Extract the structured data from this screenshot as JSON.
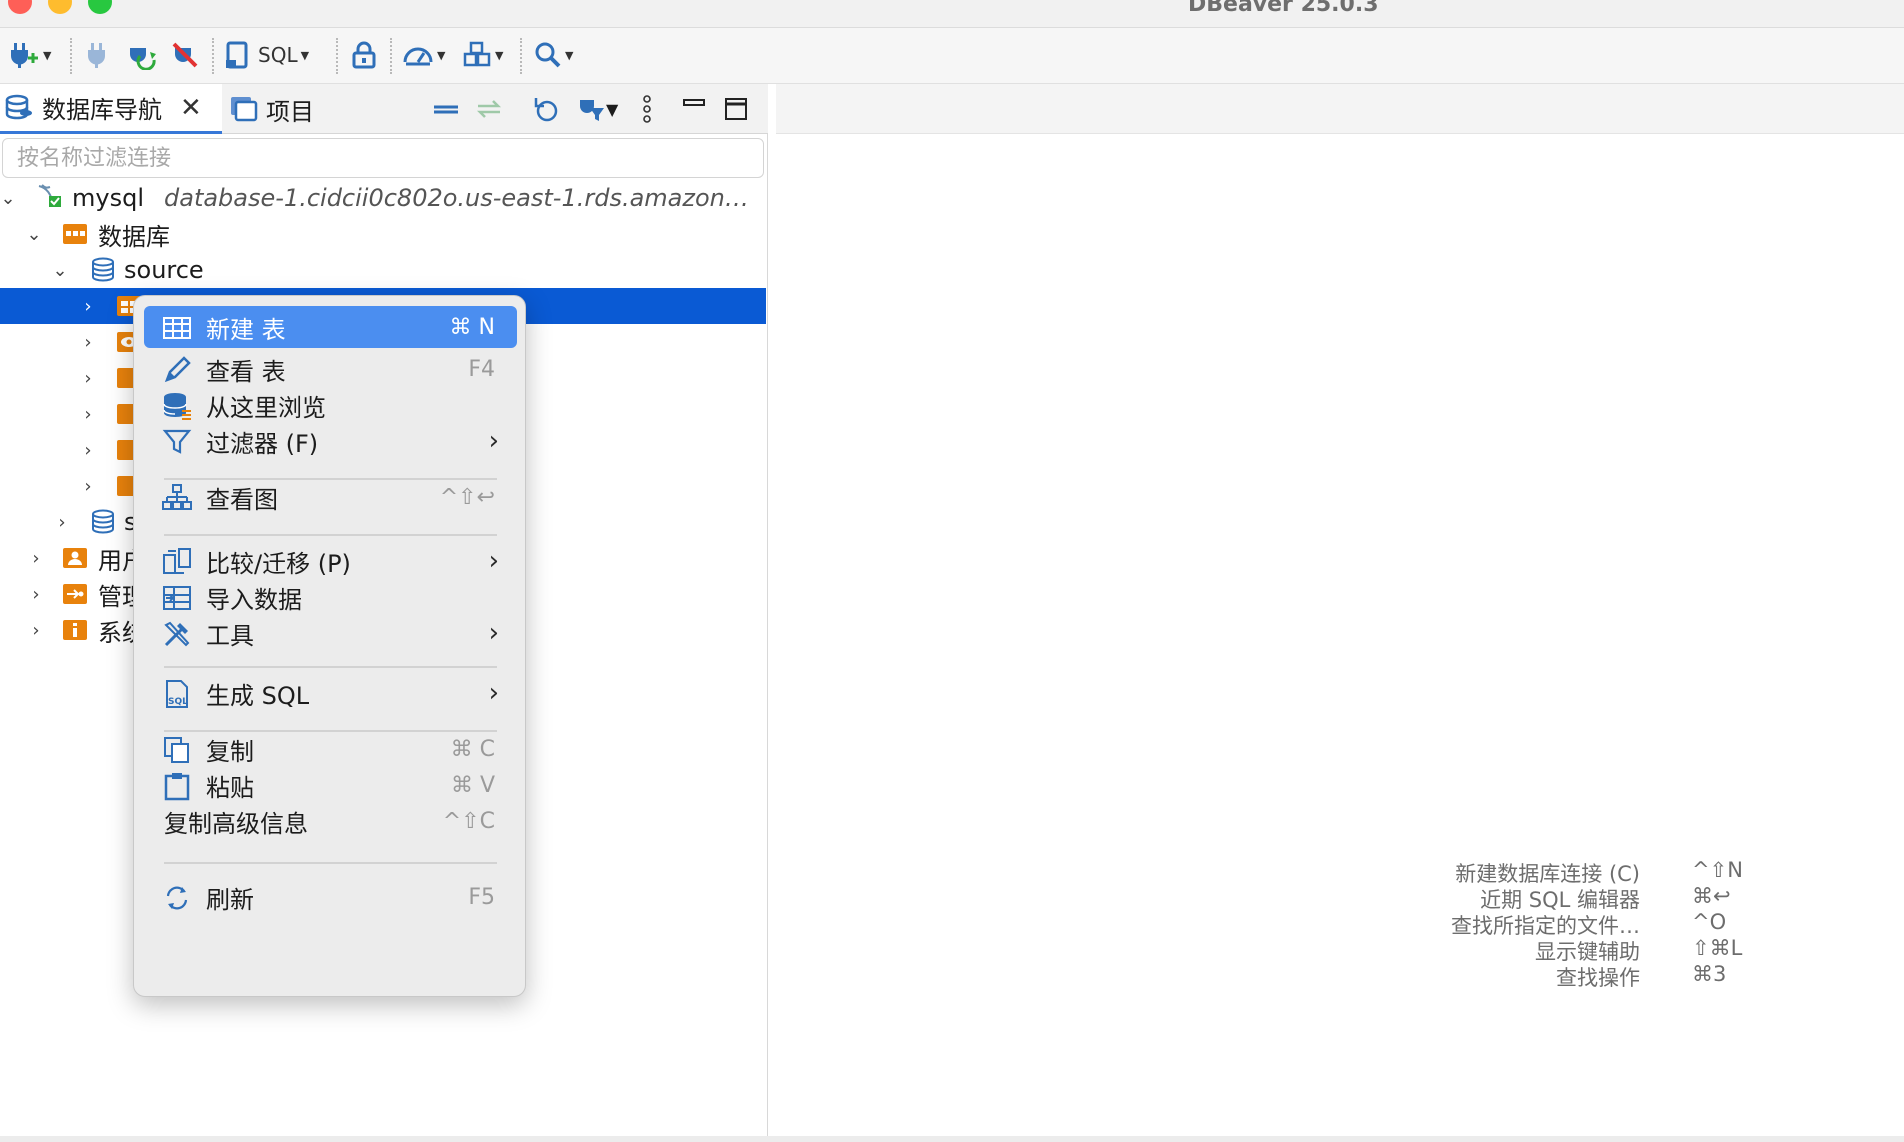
{
  "window": {
    "title": "DBeaver 25.0.3"
  },
  "toolbar": {
    "sql_label": "SQL"
  },
  "left_panel": {
    "tabs": [
      {
        "label": "数据库导航"
      },
      {
        "label": "项目"
      }
    ],
    "filter_placeholder": "按名称过滤连接",
    "tree": {
      "connection": {
        "name": "mysql",
        "host": "database-1.cidcii0c802o.us-east-1.rds.amazon…"
      },
      "databases_label": "数据库",
      "schema": "source",
      "schema2_partial": "s",
      "users_partial": "用户",
      "admin_partial": "管理",
      "system_partial": "系统"
    }
  },
  "context_menu": {
    "new_table": {
      "label": "新建 表",
      "shortcut": "⌘ N"
    },
    "view_table": {
      "label": "查看 表",
      "shortcut": "F4"
    },
    "browse_here": {
      "label": "从这里浏览"
    },
    "filter": {
      "label": "过滤器 (F)"
    },
    "view_diagram": {
      "label": "查看图",
      "shortcut": "^⇧↩"
    },
    "compare_migrate": {
      "label": "比较/迁移 (P)"
    },
    "import_data": {
      "label": "导入数据"
    },
    "tools": {
      "label": "工具"
    },
    "generate_sql": {
      "label": "生成 SQL"
    },
    "copy": {
      "label": "复制",
      "shortcut": "⌘ C"
    },
    "paste": {
      "label": "粘贴",
      "shortcut": "⌘ V"
    },
    "copy_advanced": {
      "label": "复制高级信息",
      "shortcut": "^⇧C"
    },
    "refresh": {
      "label": "刷新",
      "shortcut": "F5"
    }
  },
  "hints": [
    {
      "label": "新建数据库连接 (C)",
      "keys": "^⇧N"
    },
    {
      "label": "近期 SQL 编辑器",
      "keys": "⌘↩"
    },
    {
      "label": "查找所指定的文件…",
      "keys": "^O"
    },
    {
      "label": "显示键辅助",
      "keys": "⇧⌘L"
    },
    {
      "label": "查找操作",
      "keys": "⌘3"
    }
  ],
  "colors": {
    "selection": "#0a5ad4",
    "menu_highlight": "#4b8ef0",
    "folder_orange": "#e8820c"
  }
}
